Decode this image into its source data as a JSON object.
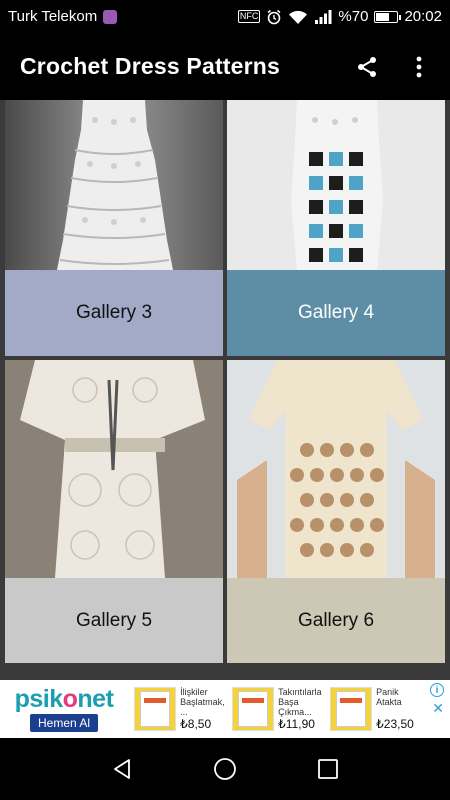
{
  "status_bar": {
    "carrier": "Turk Telekom",
    "nfc_label": "NFC",
    "battery_label": "%70",
    "battery_level": 0.7,
    "time": "20:02"
  },
  "app_bar": {
    "title": "Crochet Dress Patterns",
    "share_icon": "share-icon",
    "menu_icon": "more-vert-icon"
  },
  "galleries": [
    {
      "label": "Gallery 3",
      "caption_color": "#a3aac8"
    },
    {
      "label": "Gallery 4",
      "caption_color": "#5e8ea6"
    },
    {
      "label": "Gallery 5",
      "caption_color": "#c9c9c9"
    },
    {
      "label": "Gallery 6",
      "caption_color": "#cdc7b5"
    }
  ],
  "ad": {
    "brand": "psikonet",
    "cta": "Hemen Al",
    "products": [
      {
        "name": "İlişkiler Başlatmak, ...",
        "price": "₺8,50"
      },
      {
        "name": "Takıntılarla Başa Çıkma...",
        "price": "₺11,90"
      },
      {
        "name": "Panik Atakta",
        "price": "₺23,50"
      }
    ]
  },
  "nav_bar": {
    "back_icon": "back-icon",
    "home_icon": "home-icon",
    "recents_icon": "recents-icon"
  }
}
